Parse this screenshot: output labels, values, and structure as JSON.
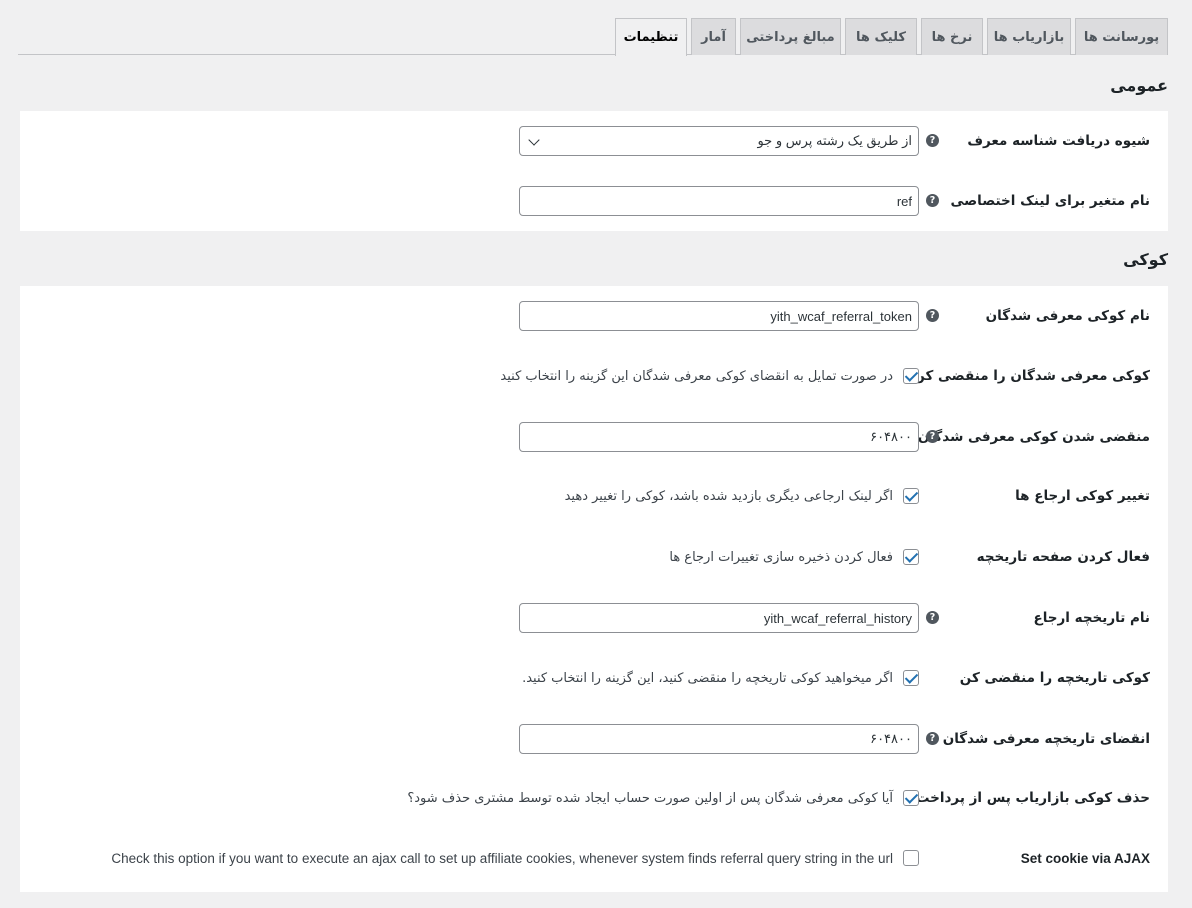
{
  "tabs": [
    {
      "label": "پورسانت ها",
      "active": false
    },
    {
      "label": "بازاریاب ها",
      "active": false
    },
    {
      "label": "نرخ ها",
      "active": false
    },
    {
      "label": "کلیک ها",
      "active": false
    },
    {
      "label": "مبالغ پرداختی",
      "active": false
    },
    {
      "label": "آمار",
      "active": false
    },
    {
      "label": "تنظیمات",
      "active": true
    }
  ],
  "general": {
    "heading": "عمومی",
    "referral_method": {
      "label": "شیوه دریافت شناسه معرف",
      "value": "از طریق یک رشته پرس و جو"
    },
    "link_variable": {
      "label": "نام متغیر برای لینک اختصاصی",
      "value": "ref"
    }
  },
  "cookie": {
    "heading": "کوکی",
    "cookie_name": {
      "label": "نام کوکی معرفی شدگان",
      "value": "yith_wcaf_referral_token"
    },
    "expire_cookie": {
      "label": "کوکی معرفی شدگان را منقضی کن",
      "checked": true,
      "desc": "در صورت تمایل به انقضای کوکی معرفی شدگان این گزینه را انتخاب کنید"
    },
    "cookie_expiration": {
      "label": "منقضی شدن کوکی معرفی شدگان",
      "value": "۶۰۴۸۰۰"
    },
    "change_cookie": {
      "label": "تغییر کوکی ارجاع ها",
      "checked": true,
      "desc": "اگر لینک ارجاعی دیگری بازدید شده باشد، کوکی را تغییر دهید"
    },
    "enable_history": {
      "label": "فعال کردن صفحه تاریخچه",
      "checked": true,
      "desc": "فعال کردن ذخیره سازی تغییرات ارجاع ها"
    },
    "history_name": {
      "label": "نام تاریخچه ارجاع",
      "value": "yith_wcaf_referral_history"
    },
    "expire_history": {
      "label": "کوکی تاریخچه را منقضی کن",
      "checked": true,
      "desc": "اگر میخواهید کوکی تاریخچه را منقضی کنید، این گزینه را انتخاب کنید."
    },
    "history_expiration": {
      "label": "انقضای تاریخچه معرفی شدگان",
      "value": "۶۰۴۸۰۰"
    },
    "delete_after_payment": {
      "label": "حذف کوکی بازاریاب پس از پرداخت",
      "checked": true,
      "desc": "آیا کوکی معرفی شدگان پس از اولین صورت حساب ایجاد شده توسط مشتری حذف شود؟"
    },
    "ajax_cookie": {
      "label": "Set cookie via AJAX",
      "checked": false,
      "desc": "Check this option if you want to execute an ajax call to set up affiliate cookies, whenever system finds referral query string in the url"
    }
  }
}
